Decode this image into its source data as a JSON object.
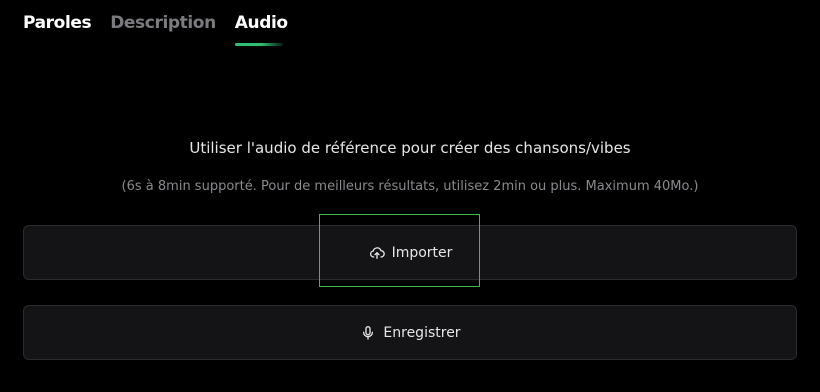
{
  "tabs": {
    "lyrics": "Paroles",
    "description": "Description",
    "audio": "Audio"
  },
  "active_tab": "audio",
  "audio_panel": {
    "title": "Utiliser l'audio de référence pour créer des chansons/vibes",
    "subtitle": "(6s à 8min supporté. Pour de meilleurs résultats, utilisez 2min ou plus. Maximum 40Mo.)",
    "import_label": "Importer",
    "record_label": "Enregistrer",
    "import_icon": "cloud-upload-icon",
    "record_icon": "microphone-icon"
  },
  "colors": {
    "background": "#000000",
    "accent": "#2fbf71",
    "highlight": "#3fb94f",
    "inactive_tab": "#7b7b7f"
  }
}
